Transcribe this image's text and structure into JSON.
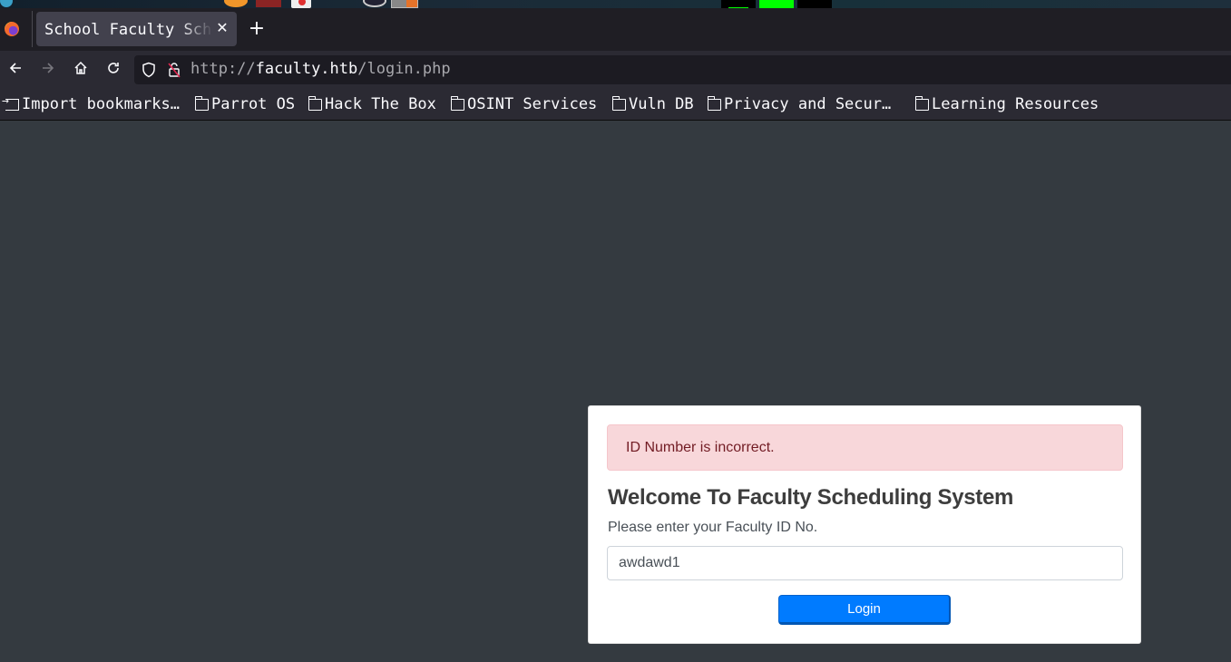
{
  "browser": {
    "tab": {
      "title": "School Faculty Scheduling System",
      "close_icon": "close-icon"
    },
    "new_tab_icon": "plus-icon",
    "nav": {
      "back_icon": "arrow-left-icon",
      "forward_icon": "arrow-right-icon",
      "home_icon": "home-icon",
      "reload_icon": "reload-icon"
    },
    "url": {
      "scheme": "http://",
      "host": "faculty.htb",
      "path": "/login.php",
      "security_icons": [
        "shield-icon",
        "insecure-lock-icon"
      ]
    },
    "bookmarks": [
      {
        "label": "Import bookmarks…",
        "icon": "import-icon"
      },
      {
        "label": "Parrot OS",
        "icon": "folder-icon"
      },
      {
        "label": "Hack The Box",
        "icon": "folder-icon"
      },
      {
        "label": "OSINT Services",
        "icon": "folder-icon"
      },
      {
        "label": "Vuln DB",
        "icon": "folder-icon"
      },
      {
        "label": "Privacy and Secur…",
        "icon": "folder-icon"
      },
      {
        "label": "Learning Resources",
        "icon": "folder-icon"
      }
    ]
  },
  "login": {
    "alert": "ID Number is incorrect.",
    "title": "Welcome To Faculty Scheduling System",
    "prompt": "Please enter your Faculty ID No.",
    "id_value": "awdawd1",
    "login_label": "Login"
  },
  "colors": {
    "page_bg": "#343a40",
    "alert_bg": "#f8d7da",
    "alert_text": "#721c24",
    "primary": "#007bff"
  }
}
